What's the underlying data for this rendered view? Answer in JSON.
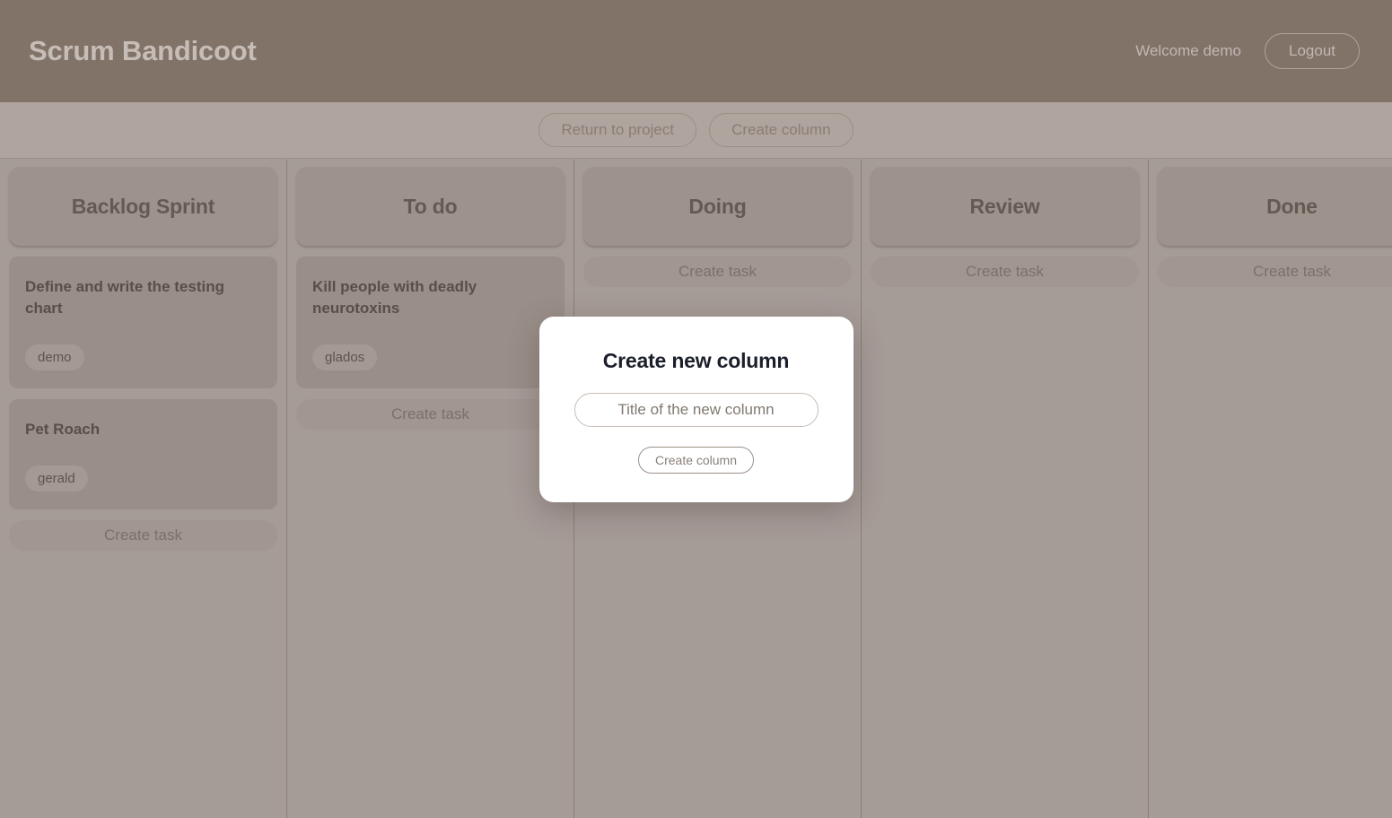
{
  "header": {
    "brand": "Scrum Bandicoot",
    "welcome": "Welcome demo",
    "logout_label": "Logout"
  },
  "toolbar": {
    "return_label": "Return to project",
    "create_column_label": "Create column"
  },
  "board": {
    "create_task_label": "Create task",
    "columns": [
      {
        "title": "Backlog Sprint",
        "tasks": [
          {
            "title": "Define and write the testing chart",
            "tags": [
              "demo"
            ]
          },
          {
            "title": "Pet Roach",
            "tags": [
              "gerald"
            ]
          }
        ]
      },
      {
        "title": "To do",
        "tasks": [
          {
            "title": "Kill people with deadly neurotoxins",
            "tags": [
              "glados"
            ]
          }
        ]
      },
      {
        "title": "Doing",
        "tasks": []
      },
      {
        "title": "Review",
        "tasks": []
      },
      {
        "title": "Done",
        "tasks": []
      }
    ]
  },
  "modal": {
    "title": "Create new column",
    "input_value": "",
    "input_placeholder": "Title of the new column",
    "submit_label": "Create column"
  },
  "colors": {
    "header_bg": "#827469",
    "toolbar_bg": "#b3a8a2",
    "column_bg": "#a89f9b",
    "column_header_bg": "#a1968f",
    "card_bg": "#9c918b",
    "tag_bg": "#a79d97",
    "modal_bg": "#ffffff",
    "modal_title": "#1b1f2b"
  }
}
